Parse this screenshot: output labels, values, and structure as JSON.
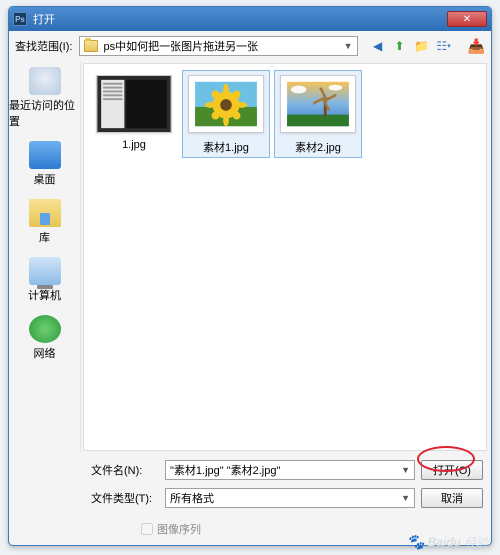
{
  "titlebar": {
    "title": "打开"
  },
  "toolbar": {
    "lookin_label": "查找范围(I):",
    "folder_name": "ps中如何把一张图片拖进另一张"
  },
  "places": [
    {
      "label": "最近访问的位置"
    },
    {
      "label": "桌面"
    },
    {
      "label": "库"
    },
    {
      "label": "计算机"
    },
    {
      "label": "网络"
    }
  ],
  "files": [
    {
      "name": "1.jpg",
      "selected": false
    },
    {
      "name": "素材1.jpg",
      "selected": true
    },
    {
      "name": "素材2.jpg",
      "selected": true
    }
  ],
  "bottom": {
    "filename_label": "文件名(N):",
    "filename_value": "\"素材1.jpg\" \"素材2.jpg\"",
    "filetype_label": "文件类型(T):",
    "filetype_value": "所有格式",
    "open_btn": "打开(O)",
    "cancel_btn": "取消",
    "sequence_label": "图像序列"
  },
  "watermark": {
    "site": "Baidu",
    "text": "经验"
  }
}
